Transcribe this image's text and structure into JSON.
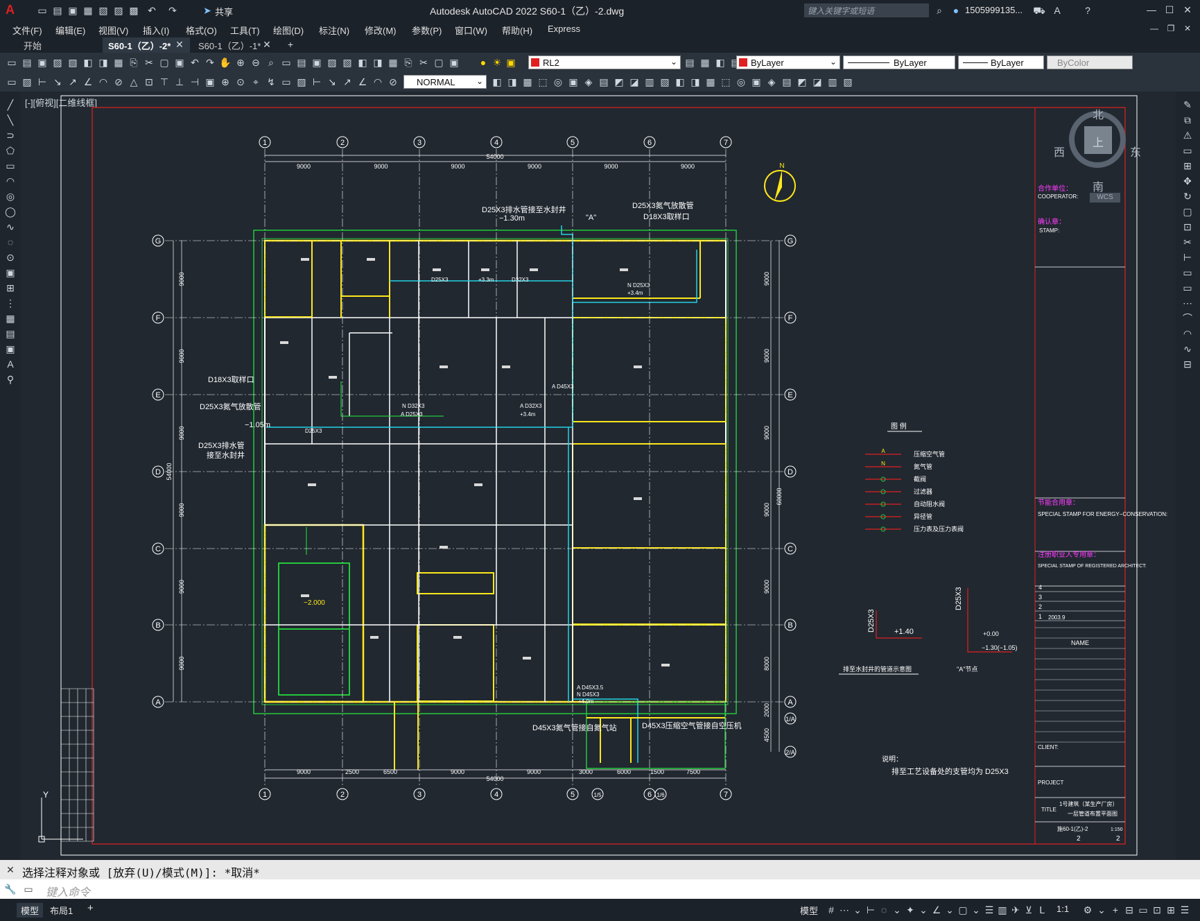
{
  "app": {
    "title": "Autodesk AutoCAD 2022    S60-1（乙）-2.dwg",
    "share": "共享",
    "search_placeholder": "键入关键字或短语",
    "user": "1505999135...",
    "logo": "A"
  },
  "menu": [
    "文件(F)",
    "编辑(E)",
    "视图(V)",
    "插入(I)",
    "格式(O)",
    "工具(T)",
    "绘图(D)",
    "标注(N)",
    "修改(M)",
    "参数(P)",
    "窗口(W)",
    "帮助(H)",
    "Express"
  ],
  "tabs": [
    {
      "label": "开始",
      "active": false
    },
    {
      "label": "S60-1（乙）-2*",
      "active": true
    },
    {
      "label": "S60-1（乙）-1*",
      "active": false
    }
  ],
  "toolbar": {
    "layer": "RL2",
    "color": "ByLayer",
    "linetype": "ByLayer",
    "lineweight": "ByLayer",
    "plotstyle": "ByColor",
    "dimstyle": "NORMAL",
    "colors": {
      "accent_red": "#e02020",
      "layer_swatch": "#e02020"
    }
  },
  "viewport": {
    "label": "[-][俯视][二维线框]"
  },
  "viewcube": {
    "north": "北",
    "south": "南",
    "east": "东",
    "west": "西",
    "top": "上",
    "wcs": "WCS"
  },
  "drawing": {
    "grid_cols": [
      "1",
      "2",
      "3",
      "4",
      "5",
      "6",
      "7"
    ],
    "grid_rows": [
      "G",
      "F",
      "E",
      "D",
      "C",
      "B",
      "A"
    ],
    "top_dims": [
      "9000",
      "9000",
      "9000",
      "9000",
      "9000",
      "9000"
    ],
    "top_total": "54000",
    "bottom_dims": [
      "9000",
      "2500",
      "6500",
      "9000",
      "9000",
      "3000",
      "6000",
      "1500",
      "7500"
    ],
    "bottom_total": "54000",
    "bottom_extra_cols": [
      "5",
      "1/5",
      "1/6",
      "6",
      "7"
    ],
    "right_dims": [
      "9000",
      "9000",
      "9000",
      "9000",
      "9000",
      "8000",
      "2000",
      "4500"
    ],
    "right_total": "60000",
    "left_dims": [
      "9000",
      "9000",
      "9000",
      "9000",
      "9000",
      "9000"
    ],
    "left_total": "54000",
    "right_extra_rows": [
      "1/A",
      "2/A"
    ],
    "annotations": [
      "D25X3排水管接至水封井",
      "−1.30m",
      "\"A\"",
      "D25X3氮气放散管",
      "D18X3取样口",
      "D18X3取样口",
      "D25X3氮气放散管",
      "D25X3排水管",
      "接至水封井",
      "−1.05m",
      "D45X3氮气管接自氮气站",
      "D45X3压缩空气管接自空压机"
    ],
    "pipe_labels": [
      "D25X3",
      "+3.3m",
      "D32X3",
      "N D25X3",
      "+3.4m",
      "A D45X3",
      "N D32X3",
      "A D25X3",
      "A D32X3",
      "+3.4m",
      "D25X3",
      "A D45X3.5",
      "N D45X3",
      "+4.0m"
    ],
    "elevation": "−2.000",
    "compass": "N",
    "legend": {
      "title": "图    例",
      "items": [
        {
          "sym": "A",
          "text": "压缩空气管"
        },
        {
          "sym": "N",
          "text": "氮气管"
        },
        {
          "sym": "",
          "text": "截阀"
        },
        {
          "sym": "",
          "text": "过滤器"
        },
        {
          "sym": "",
          "text": "自动阻水阀"
        },
        {
          "sym": "",
          "text": "异径管"
        },
        {
          "sym": "",
          "text": "压力表及压力表阀"
        }
      ]
    },
    "detail1": {
      "pipe": "D25X3",
      "elev": "+1.40",
      "caption": "排至水封井的管道示意图"
    },
    "detail2": {
      "pipe": "D25X3",
      "elev1": "+0.00",
      "elev2": "−1.30(−1.05)",
      "caption": "\"A\"节点"
    },
    "note": {
      "title": "说明：",
      "text": "排至工艺设备处的支管均为 D25X3"
    }
  },
  "titleblock": {
    "cooperator_cn": "合作单位：",
    "cooperator": "COOPERATOR:",
    "stamp_cn": "确认章：",
    "stamp": "STAMP:",
    "energy_cn": "节能合用章：",
    "energy": "SPECIAL STAMP FOR ENERGY−CONSERVATION:",
    "architect_cn": "注册职业人专用章：",
    "architect": "SPECIAL STAMP OF REGISTERED ARCHITECT:",
    "rev_rows": [
      "4",
      "3",
      "2",
      "1"
    ],
    "rev_date": "2003.9",
    "name": "NAME",
    "client": "CLIENT:",
    "project": "PROJECT",
    "title": "TITLE",
    "title_cn1": "1号建筑（某生产厂房）",
    "title_cn2": "一层管道布置平面图",
    "drawing_no": "施60-1(乙)-2",
    "scale": "1:150",
    "sheet": "2",
    "total": "2"
  },
  "command": {
    "history": "选择注释对象或 [放弃(U)/模式(M)]: *取消*",
    "placeholder": "键入命令"
  },
  "layouts": [
    "模型",
    "布局1"
  ],
  "status": {
    "model": "模型",
    "scale": "1:1"
  }
}
